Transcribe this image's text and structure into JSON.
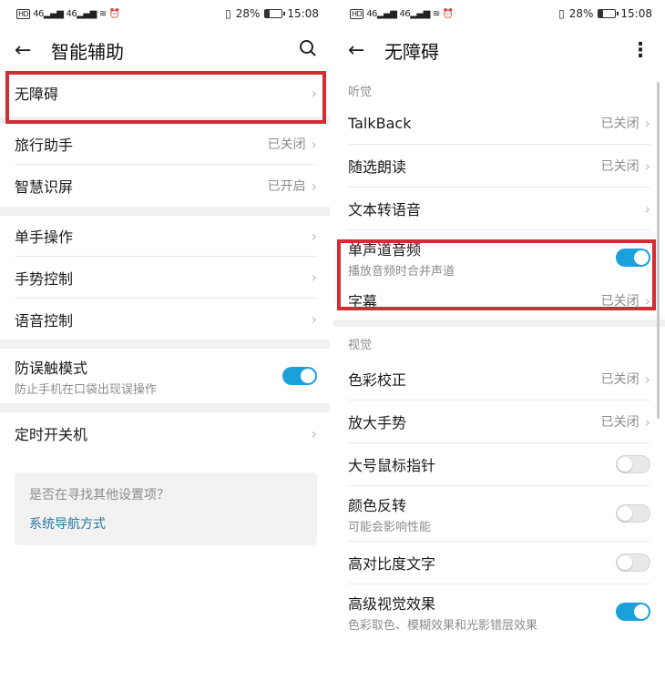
{
  "status": {
    "hd": "HD",
    "net1": "46",
    "net2": "46",
    "battery": "28%",
    "time": "15:08"
  },
  "left": {
    "title": "智能辅助",
    "rows": {
      "accessibility": "无障碍",
      "travel": "旅行助手",
      "travel_status": "已关闭",
      "smart_screen": "智慧识屏",
      "smart_screen_status": "已开启",
      "one_hand": "单手操作",
      "gesture": "手势控制",
      "voice": "语音控制",
      "mistouch": "防误触模式",
      "mistouch_sub": "防止手机在口袋出现误操作",
      "timer": "定时开关机"
    },
    "card": {
      "question": "是否在寻找其他设置项？",
      "link": "系统导航方式"
    }
  },
  "right": {
    "title": "无障碍",
    "section_hearing": "听觉",
    "talkback": "TalkBack",
    "talkback_status": "已关闭",
    "select_read": "随选朗读",
    "select_read_status": "已关闭",
    "tts": "文本转语音",
    "mono_audio": "单声道音频",
    "mono_audio_sub": "播放音频时合并声道",
    "subtitles": "字幕",
    "subtitles_status": "已关闭",
    "section_vision": "视觉",
    "color_correction": "色彩校正",
    "color_correction_status": "已关闭",
    "magnify": "放大手势",
    "magnify_status": "已关闭",
    "large_pointer": "大号鼠标指针",
    "invert": "颜色反转",
    "invert_sub": "可能会影响性能",
    "high_contrast": "高对比度文字",
    "advanced_visual": "高级视觉效果",
    "advanced_visual_sub": "色彩取色、模糊效果和光影错层效果"
  },
  "toggles": {
    "mistouch": true,
    "mono_audio": true,
    "large_pointer": false,
    "invert": false,
    "high_contrast": false,
    "advanced_visual": true
  },
  "icons": {
    "back": "arrow-left-icon",
    "search": "search-icon",
    "more": "more-vertical-icon",
    "chevron": "chevron-right-icon"
  },
  "colors": {
    "accent": "#1aa1dc",
    "highlight": "#d52b33",
    "link": "#2a76a3"
  }
}
